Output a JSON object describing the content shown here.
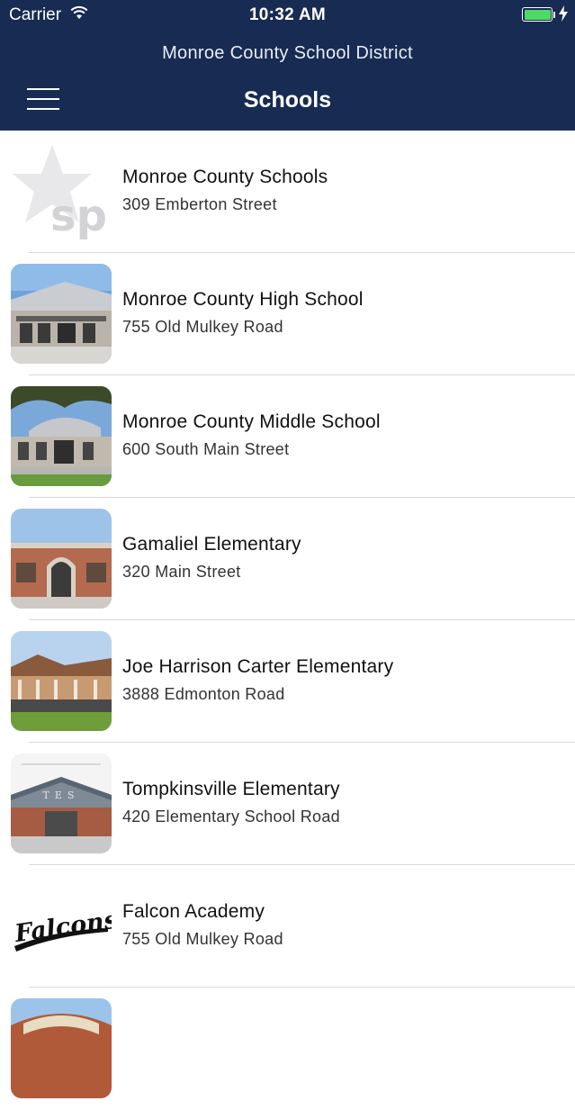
{
  "status_bar": {
    "carrier": "Carrier",
    "time": "10:32 AM",
    "battery_level": 1.0
  },
  "header": {
    "district": "Monroe County School District",
    "title": "Schools"
  },
  "schools": [
    {
      "name": "Monroe County Schools",
      "address": "309 Emberton Street",
      "thumb": "schoolpointe-star-logo"
    },
    {
      "name": "Monroe County High School",
      "address": "755 Old Mulkey Road",
      "thumb": "high-school-building-photo"
    },
    {
      "name": "Monroe County Middle School",
      "address": "600 South Main Street",
      "thumb": "middle-school-building-photo"
    },
    {
      "name": "Gamaliel Elementary",
      "address": "320 Main Street",
      "thumb": "gamaliel-building-photo"
    },
    {
      "name": "Joe Harrison Carter Elementary",
      "address": "3888 Edmonton Road",
      "thumb": "carter-building-photo"
    },
    {
      "name": "Tompkinsville Elementary",
      "address": "420 Elementary School Road",
      "thumb": "tes-building-photo"
    },
    {
      "name": "Falcon Academy",
      "address": "755 Old Mulkey Road",
      "thumb": "falcons-logo"
    },
    {
      "name": "",
      "address": "",
      "thumb": "monroe-county-sign-photo"
    }
  ],
  "colors": {
    "header_bg": "#172b53",
    "battery": "#4cd964"
  }
}
